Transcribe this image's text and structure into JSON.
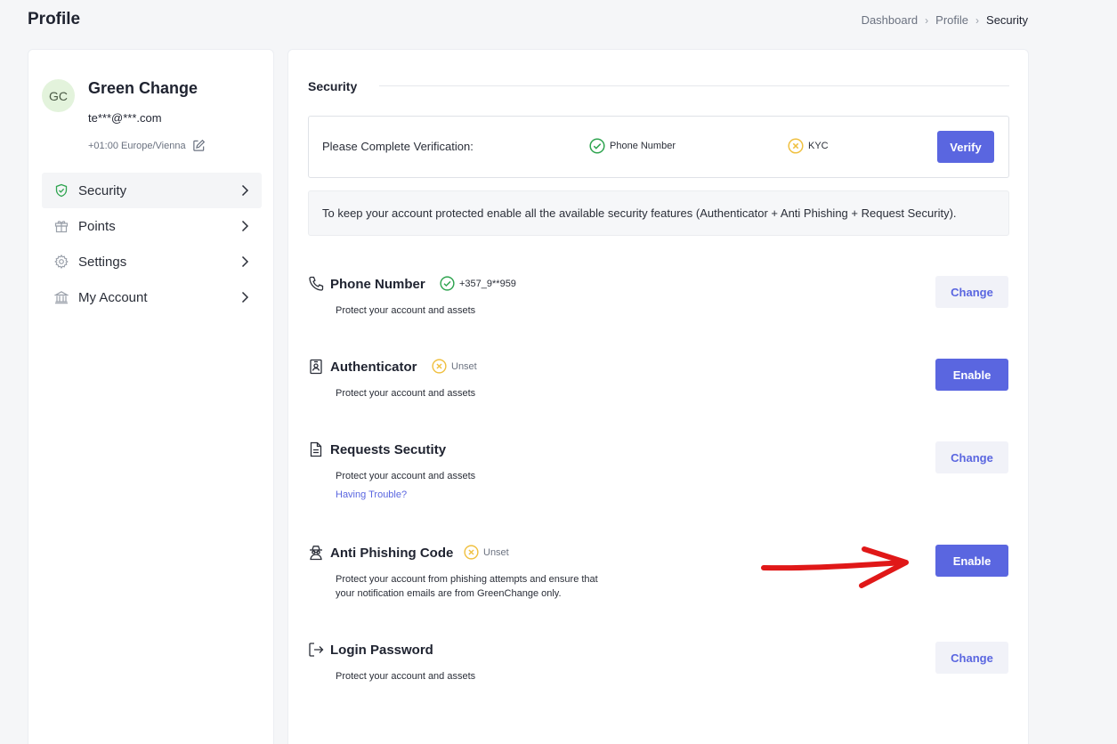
{
  "header": {
    "title": "Profile",
    "breadcrumb": [
      "Dashboard",
      "Profile",
      "Security"
    ]
  },
  "user": {
    "initials": "GC",
    "name": "Green Change",
    "email": "te***@***.com",
    "timezone": "+01:00 Europe/Vienna"
  },
  "sidebar": {
    "items": [
      {
        "label": "Security",
        "icon": "shield-icon",
        "active": true
      },
      {
        "label": "Points",
        "icon": "gift-icon"
      },
      {
        "label": "Settings",
        "icon": "gear-icon"
      },
      {
        "label": "My Account",
        "icon": "bank-icon"
      }
    ]
  },
  "main": {
    "section_title": "Security",
    "verification": {
      "text": "Please Complete Verification:",
      "phone_label": "Phone Number",
      "kyc_label": "KYC",
      "button": "Verify"
    },
    "info": "To keep your account protected enable all the available security features (Authenticator + Anti Phishing + Request Security).",
    "features": [
      {
        "title": "Phone Number",
        "status": "+357_9**959",
        "status_type": "ok",
        "desc": "Protect your account and assets",
        "button": "Change",
        "icon": "phone-icon"
      },
      {
        "title": "Authenticator",
        "status": "Unset",
        "status_type": "unset",
        "desc": "Protect your account and assets",
        "button": "Enable",
        "icon": "authenticator-icon"
      },
      {
        "title": "Requests Secutity",
        "desc": "Protect your account and assets",
        "link": "Having Trouble?",
        "button": "Change",
        "icon": "document-icon"
      },
      {
        "title": "Anti Phishing Code",
        "status": "Unset",
        "status_type": "unset",
        "desc": "Protect your account from phishing attempts and ensure that your notification emails are from GreenChange only.",
        "button": "Enable",
        "icon": "spy-icon"
      },
      {
        "title": "Login Password",
        "desc": "Protect your account and assets",
        "button": "Change",
        "icon": "logout-icon"
      }
    ]
  },
  "colors": {
    "primary": "#5a66e0",
    "success": "#2ea44f",
    "warning": "#f0c040",
    "annotation_arrow": "#e01818"
  }
}
